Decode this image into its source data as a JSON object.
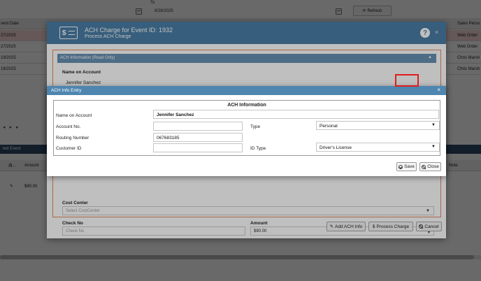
{
  "background": {
    "to_label": "To",
    "to_date": "8/28/2025",
    "refresh_label": "Refresh",
    "col_event_date": "vent Date",
    "col_sales_person": "Sales Perso",
    "rows": [
      {
        "date": "27/2025",
        "right": "Web Order"
      },
      {
        "date": "27/2025",
        "right": "Web Order"
      },
      {
        "date": "19/2025",
        "right": "Chris Marsh"
      },
      {
        "date": "18/2025",
        "right": "Chris Marsh"
      }
    ],
    "section_title": "ted Event",
    "grid_a": "A...",
    "grid_amount": "Amount",
    "grid_note": "Note",
    "grid_amount_value": "$90.00"
  },
  "charge_dialog": {
    "title": "ACH Charge for Event ID: 1932",
    "subtitle": "Process ACH Charge",
    "help": "?",
    "close": "×",
    "ro_panel_title": "ACH Information (Read Only)",
    "name_label": "Name on Account",
    "name_value": "Jennifer Sanchez",
    "cost_center_label": "Cost Center",
    "cost_center_placeholder": "Select CostCenter",
    "check_no_label": "Check No",
    "check_no_placeholder": "Check No",
    "amount_label": "Amount",
    "amount_value": "$90.00",
    "btn_add_ach": "Add ACH Info",
    "btn_process": "Process Charge",
    "btn_cancel": "Cancel"
  },
  "entry_dialog": {
    "title": "ACH Info Entry",
    "close": "×",
    "section_title": "ACH Information",
    "name_label": "Name on Account",
    "name_value": "Jennifer Sanchez",
    "account_label": "Account No.",
    "account_value": "",
    "type_label": "Type",
    "type_value": "Personal",
    "routing_label": "Routing Number",
    "routing_value": "067683185",
    "customer_id_label": "Customer ID",
    "customer_id_value": "",
    "id_type_label": "ID Type",
    "id_type_value": "Driver's License",
    "save_label": "Save",
    "close_label": "Close"
  },
  "colors": {
    "header_blue": "#4a7ea6",
    "entry_header_blue": "#4f86b0",
    "highlight_red": "#e01b1b",
    "body_border_orange": "#e38b5e"
  }
}
